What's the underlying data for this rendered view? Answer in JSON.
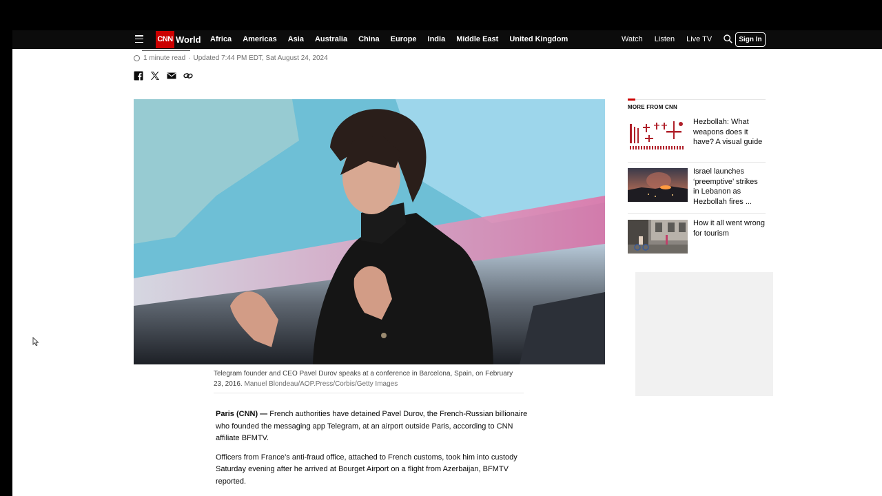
{
  "nav": {
    "logo": "CNN",
    "section": "World",
    "links": [
      "Africa",
      "Americas",
      "Asia",
      "Australia",
      "China",
      "Europe",
      "India",
      "Middle East",
      "United Kingdom"
    ],
    "right_links": [
      "Watch",
      "Listen",
      "Live TV"
    ],
    "sign_in": "Sign In"
  },
  "meta": {
    "read_time": "1 minute read",
    "separator": "·",
    "updated": "Updated 7:44 PM EDT, Sat August 24, 2024"
  },
  "image": {
    "caption": "Telegram founder and CEO Pavel Durov speaks at a conference in Barcelona, Spain, on February 23, 2016.",
    "credit": "Manuel Blondeau/AOP.Press/Corbis/Getty Images"
  },
  "article": {
    "dateline": "Paris (CNN) —",
    "paragraph1": "French authorities have detained Pavel Durov, the French-Russian billionaire who founded the messaging app Telegram, at an airport outside Paris, according to CNN affiliate BFMTV.",
    "paragraph2": "Officers from France’s anti-fraud office, attached to French customs, took him into custody Saturday evening after he arrived at Bourget Airport on a flight from Azerbaijan, BFMTV reported."
  },
  "sidebar": {
    "heading": "MORE FROM CNN",
    "items": [
      {
        "title": "Hezbollah: What weapons does it have? A visual guide"
      },
      {
        "title": "Israel launches ‘preemptive’ strikes in Lebanon as Hezbollah fires ..."
      },
      {
        "title": "How it all went wrong for tourism"
      }
    ]
  },
  "icons": {
    "menu": "hamburger-menu-icon",
    "search": "search-icon",
    "clock": "clock-icon",
    "share": [
      "facebook-icon",
      "x-icon",
      "email-icon",
      "link-icon"
    ]
  },
  "colors": {
    "brand_red": "#cc0000",
    "nav_bg": "#0c0c0c",
    "text": "#0c0c0c",
    "muted": "#6e6e6e"
  }
}
